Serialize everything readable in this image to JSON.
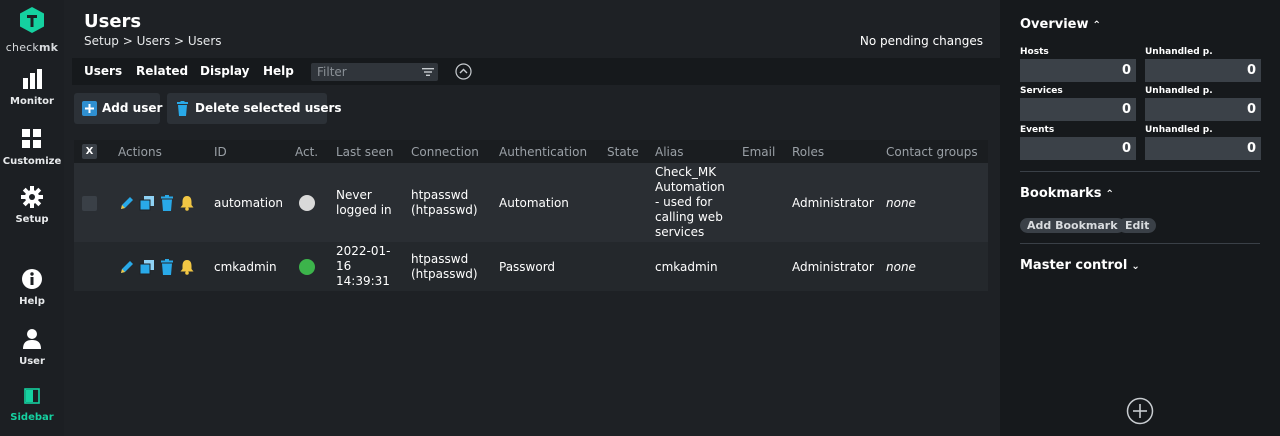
{
  "nav": {
    "logo_text_a": "check",
    "logo_text_b": "mk",
    "items": [
      {
        "label": "Monitor"
      },
      {
        "label": "Customize"
      },
      {
        "label": "Setup"
      },
      {
        "label": "Help"
      },
      {
        "label": "User"
      },
      {
        "label": "Sidebar"
      }
    ]
  },
  "page": {
    "title": "Users",
    "breadcrumb": "Setup > Users > Users",
    "pending": "No pending changes"
  },
  "menu": {
    "items": [
      "Users",
      "Related",
      "Display",
      "Help"
    ],
    "filter_placeholder": "Filter"
  },
  "buttons": {
    "add_user": "Add user",
    "delete_selected": "Delete selected users"
  },
  "table": {
    "select_all": "X",
    "columns": [
      "Actions",
      "ID",
      "Act.",
      "Last seen",
      "Connection",
      "Authentication",
      "State",
      "Alias",
      "Email",
      "Roles",
      "Contact groups"
    ],
    "rows": [
      {
        "id": "automation",
        "active": false,
        "last_seen": [
          "Never",
          "logged in"
        ],
        "connection": [
          "htpasswd",
          "(htpasswd)"
        ],
        "authentication": "Automation",
        "alias": [
          "Check_MK",
          "Automation",
          "- used for",
          "calling web",
          "services"
        ],
        "roles": "Administrator",
        "contact_groups": "none"
      },
      {
        "id": "cmkadmin",
        "active": true,
        "last_seen": [
          "2022-01-",
          "16",
          "14:39:31"
        ],
        "connection": [
          "htpasswd",
          "(htpasswd)"
        ],
        "authentication": "Password",
        "alias": [
          "cmkadmin"
        ],
        "roles": "Administrator",
        "contact_groups": "none"
      }
    ]
  },
  "sidebar": {
    "overview": {
      "title": "Overview",
      "rows": [
        {
          "label": "Hosts",
          "value": "0",
          "unhandled_label": "Unhandled p.",
          "unhandled_value": "0"
        },
        {
          "label": "Services",
          "value": "0",
          "unhandled_label": "Unhandled p.",
          "unhandled_value": "0"
        },
        {
          "label": "Events",
          "value": "0",
          "unhandled_label": "Unhandled p.",
          "unhandled_value": "0"
        }
      ]
    },
    "bookmarks": {
      "title": "Bookmarks",
      "add": "Add Bookmark",
      "edit": "Edit"
    },
    "master_control": {
      "title": "Master control"
    }
  },
  "colors": {
    "accent": "#15d1a0",
    "active_dot": "#3cb44b",
    "inactive_dot": "#d9d9d9"
  }
}
